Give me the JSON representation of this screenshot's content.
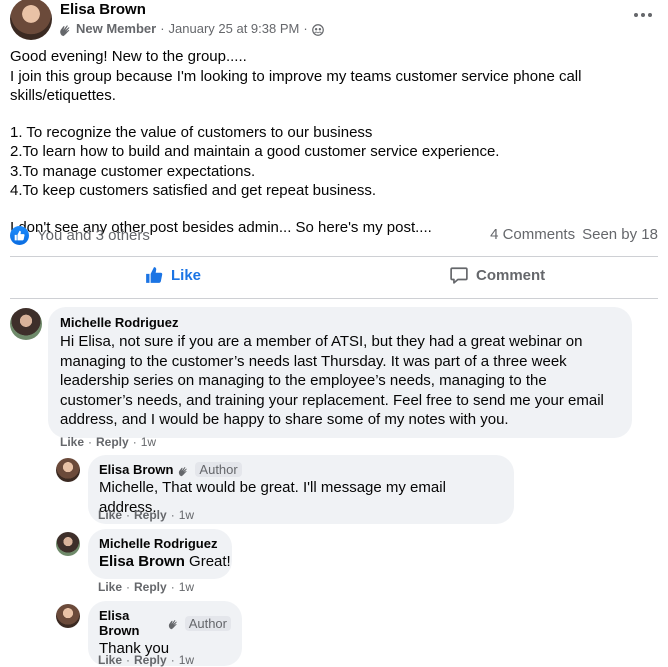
{
  "post": {
    "author": "Elisa Brown",
    "badge": "New Member",
    "date": "January 25 at 9:38 PM",
    "separator": "·",
    "paragraph1_line1": "Good evening! New to the group.....",
    "paragraph1_line2": "I join this group because I'm looking to improve my teams customer service phone call skills/etiquettes.",
    "goals": [
      "1. To recognize the value of customers to our business",
      "2.To learn how to build and maintain a good customer service experience.",
      "3.To manage customer expectations.",
      "4.To keep customers satisfied and get repeat business."
    ],
    "closing": "I don't see any other post besides admin... So here's my post...."
  },
  "reactions": {
    "text": "You and 3 others",
    "comments": "4 Comments",
    "seen": "Seen by 18"
  },
  "actions": {
    "like": "Like",
    "comment": "Comment"
  },
  "comments": [
    {
      "name": "Michelle Rodriguez",
      "text": "Hi Elisa, not sure if you are a member of ATSI, but they had a great webinar on managing to the customer’s needs last Thursday. It was part of a three week leadership series on managing to the employee’s needs, managing to the customer’s needs, and training your replacement. Feel free to send me your email address, and I would be happy to share some of my notes with you.",
      "like": "Like",
      "reply": "Reply",
      "time": "1w"
    },
    {
      "name": "Elisa Brown",
      "tag": "Author",
      "text": "Michelle, That would be great. I'll message my email address.",
      "like": "Like",
      "reply": "Reply",
      "time": "1w"
    },
    {
      "name": "Michelle Rodriguez",
      "mention": "Elisa Brown",
      "text": "Great!",
      "like": "Like",
      "reply": "Reply",
      "time": "1w"
    },
    {
      "name": "Elisa Brown",
      "tag": "Author",
      "text": "Thank you",
      "like": "Like",
      "reply": "Reply",
      "time": "1w"
    }
  ],
  "colors": {
    "accent": "#1b74e4",
    "secondary_text": "#65676b",
    "bubble": "#f0f2f5"
  },
  "icons": [
    "wave-icon",
    "globe-group-icon",
    "more-options-icon",
    "like-reaction-icon",
    "like-thumb-icon",
    "comment-icon"
  ]
}
